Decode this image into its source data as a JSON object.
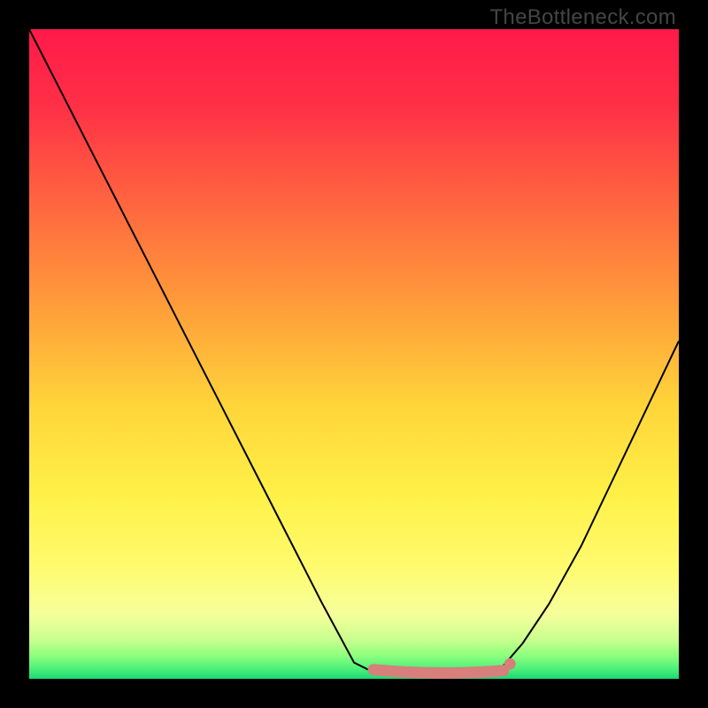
{
  "credit": "TheBottleneck.com",
  "chart_data": {
    "type": "line",
    "title": "",
    "xlabel": "",
    "ylabel": "",
    "xlim": [
      0,
      1
    ],
    "ylim": [
      0,
      1
    ],
    "series": [
      {
        "name": "curve",
        "x": [
          0.0,
          0.05,
          0.1,
          0.15,
          0.2,
          0.25,
          0.3,
          0.35,
          0.4,
          0.45,
          0.5,
          0.53,
          0.552,
          0.58,
          0.62,
          0.66,
          0.7,
          0.73,
          0.76,
          0.8,
          0.85,
          0.9,
          0.95,
          1.0
        ],
        "y": [
          1.0,
          0.902,
          0.804,
          0.706,
          0.608,
          0.51,
          0.412,
          0.314,
          0.216,
          0.118,
          0.025,
          0.01,
          0.006,
          0.005,
          0.005,
          0.006,
          0.01,
          0.02,
          0.055,
          0.115,
          0.205,
          0.31,
          0.415,
          0.52
        ]
      }
    ],
    "marker_band": {
      "color": "#d77f7a",
      "x_range": [
        0.53,
        0.73
      ],
      "y": 0.01,
      "dot_x": 0.74,
      "dot_y": 0.023
    },
    "background_gradient_stops": [
      {
        "pos": 0.0,
        "color": "#ff1a4a"
      },
      {
        "pos": 0.12,
        "color": "#ff3046"
      },
      {
        "pos": 0.28,
        "color": "#ff6a3f"
      },
      {
        "pos": 0.44,
        "color": "#ffa23a"
      },
      {
        "pos": 0.58,
        "color": "#ffd53a"
      },
      {
        "pos": 0.72,
        "color": "#fff148"
      },
      {
        "pos": 0.83,
        "color": "#fffb70"
      },
      {
        "pos": 0.9,
        "color": "#f6ff9b"
      },
      {
        "pos": 0.94,
        "color": "#c8ff8e"
      },
      {
        "pos": 0.965,
        "color": "#8cff7e"
      },
      {
        "pos": 0.985,
        "color": "#4cf07a"
      },
      {
        "pos": 1.0,
        "color": "#1cd973"
      }
    ]
  }
}
